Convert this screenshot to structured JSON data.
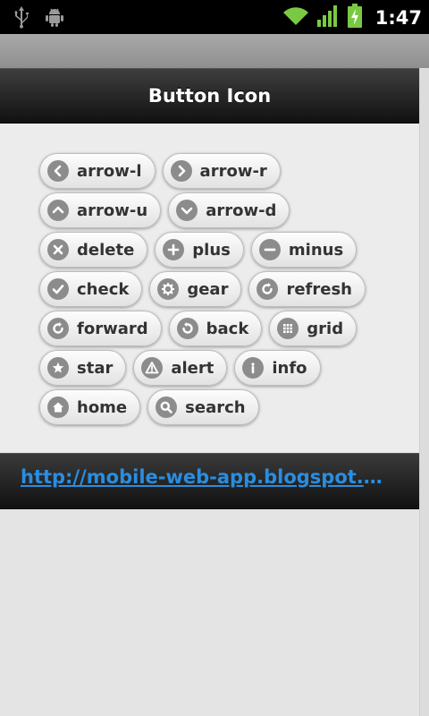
{
  "statusbar": {
    "time": "1:47",
    "icons": [
      "usb-icon",
      "android-debug-icon",
      "wifi-icon",
      "signal-icon",
      "battery-charging-icon"
    ],
    "accent": "#7ac943"
  },
  "header": {
    "title": "Button Icon"
  },
  "buttons": [
    {
      "label": "arrow-l",
      "icon": "arrow-l-icon"
    },
    {
      "label": "arrow-r",
      "icon": "arrow-r-icon"
    },
    {
      "label": "arrow-u",
      "icon": "arrow-u-icon"
    },
    {
      "label": "arrow-d",
      "icon": "arrow-d-icon"
    },
    {
      "label": "delete",
      "icon": "delete-icon"
    },
    {
      "label": "plus",
      "icon": "plus-icon"
    },
    {
      "label": "minus",
      "icon": "minus-icon"
    },
    {
      "label": "check",
      "icon": "check-icon"
    },
    {
      "label": "gear",
      "icon": "gear-icon"
    },
    {
      "label": "refresh",
      "icon": "refresh-icon"
    },
    {
      "label": "forward",
      "icon": "forward-icon"
    },
    {
      "label": "back",
      "icon": "back-icon"
    },
    {
      "label": "grid",
      "icon": "grid-icon"
    },
    {
      "label": "star",
      "icon": "star-icon"
    },
    {
      "label": "alert",
      "icon": "alert-icon"
    },
    {
      "label": "info",
      "icon": "info-icon"
    },
    {
      "label": "home",
      "icon": "home-icon"
    },
    {
      "label": "search",
      "icon": "search-icon"
    }
  ],
  "footer": {
    "link_text": "http://mobile-web-app.blogspot.com/"
  },
  "colors": {
    "icon_bg": "#8c8c8c",
    "link": "#2a8de0",
    "header_bg": "#1e1e1e"
  }
}
